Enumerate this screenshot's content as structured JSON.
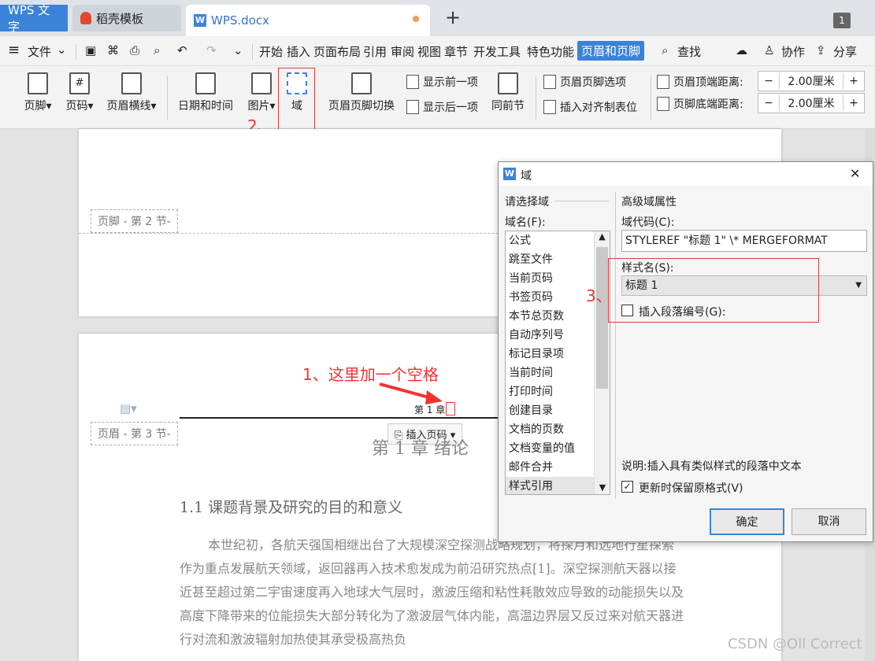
{
  "tabs": {
    "app": "WPS 文字",
    "template": "稻壳模板",
    "doc": "WPS.docx",
    "plus": "+",
    "window_badge": "1"
  },
  "menu": {
    "hamburger": "≡",
    "file": "文件",
    "items": [
      "开始",
      "插入",
      "页面布局",
      "引用",
      "审阅",
      "视图",
      "章节",
      "开发工具",
      "特色功能"
    ],
    "active": "页眉和页脚",
    "search": "查找",
    "collab": "协作",
    "share": "分享"
  },
  "ribbon": {
    "footer": "页脚",
    "pagenum": "页码",
    "header_line": "页眉横线",
    "datetime": "日期和时间",
    "picture": "图片",
    "field": "域",
    "switch": "页眉页脚切换",
    "prev": "显示前一项",
    "next": "显示后一项",
    "same_prev": "同前节",
    "options": "页眉页脚选项",
    "align_tab": "插入对齐制表位",
    "header_top_label": "页眉顶端距离:",
    "header_top_value": "2.00厘米",
    "footer_bottom_label": "页脚底端距离:",
    "footer_bottom_value": "2.00厘米",
    "minus": "−",
    "plus": "+"
  },
  "doc": {
    "footer_tag": "页脚 - 第 2 节-",
    "header_tag": "页眉 - 第 3 节-",
    "header_text": "第 1 章",
    "insert_pagenum": "插入页码",
    "chapter_title": "第 1 章 绪论",
    "section_title": "1.1 课题背景及研究的目的和意义",
    "paragraph": "本世纪初，各航天强国相继出台了大规模深空探测战略规划，将探月和远地行星探索作为重点发展航天领域，返回器再入技术愈发成为前沿研究热点[1]。深空探测航天器以接近甚至超过第二宇宙速度再入地球大气层时，激波压缩和粘性耗散效应导致的动能损失以及高度下降带来的位能损失大部分转化为了激波层气体内能，高温边界层又反过来对航天器进行对流和激波辐射加热使其承受极高热负"
  },
  "annotations": {
    "a1": "1、这里加一个空格",
    "a2": "2、",
    "a3": "3、"
  },
  "dialog": {
    "title": "域",
    "close": "✕",
    "choose_label": "请选择域",
    "name_label": "域名(F):",
    "fields": [
      "公式",
      "跳至文件",
      "当前页码",
      "书签页码",
      "本节总页数",
      "自动序列号",
      "标记目录项",
      "当前时间",
      "打印时间",
      "创建目录",
      "文档的页数",
      "文档变量的值",
      "邮件合并",
      "样式引用"
    ],
    "selected": "样式引用",
    "adv_label": "高级域属性",
    "code_label": "域代码(C):",
    "code_value": "STYLEREF \"标题 1\" \\* MERGEFORMAT",
    "style_label": "样式名(S):",
    "style_value": "标题 1",
    "para_num_label": "插入段落编号(G):",
    "desc": "说明:插入具有类似样式的段落中文本",
    "keep_format": "更新时保留原格式(V)",
    "ok": "确定",
    "cancel": "取消"
  },
  "watermark": "CSDN @Oll Correct",
  "colors": {
    "accent": "#3b83d8",
    "annotation": "#e33333"
  }
}
